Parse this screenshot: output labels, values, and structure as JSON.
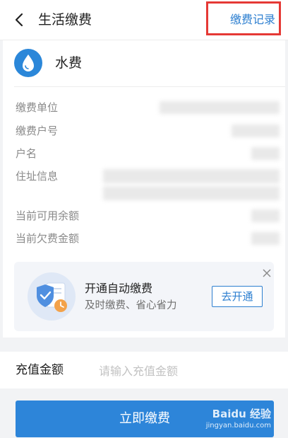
{
  "header": {
    "title": "生活缴费",
    "record_link": "缴费记录",
    "back_icon": "chevron-left-icon"
  },
  "bill": {
    "type_title": "水费",
    "icon": "water-drop-icon",
    "icon_color": "#2b87d9"
  },
  "info_rows": [
    {
      "label": "缴费单位"
    },
    {
      "label": "缴费户号"
    },
    {
      "label": "户名"
    },
    {
      "label": "住址信息"
    },
    {
      "label": "当前可用余额"
    },
    {
      "label": "当前欠费金额"
    }
  ],
  "promo": {
    "title": "开通自动缴费",
    "subtitle": "及时缴费、省心省力",
    "button": "去开通",
    "icon": "shield-document-clock-icon",
    "close_icon": "close-icon"
  },
  "amount": {
    "label": "充值金额",
    "placeholder": "请输入充值金额",
    "value": ""
  },
  "pay_button": "立即缴费",
  "watermark": {
    "brand": "Baidu 经验",
    "url": "jingyan.baidu.com"
  },
  "colors": {
    "accent": "#2d7fd0",
    "button": "#2d85d9",
    "annotation": "#e53935"
  }
}
